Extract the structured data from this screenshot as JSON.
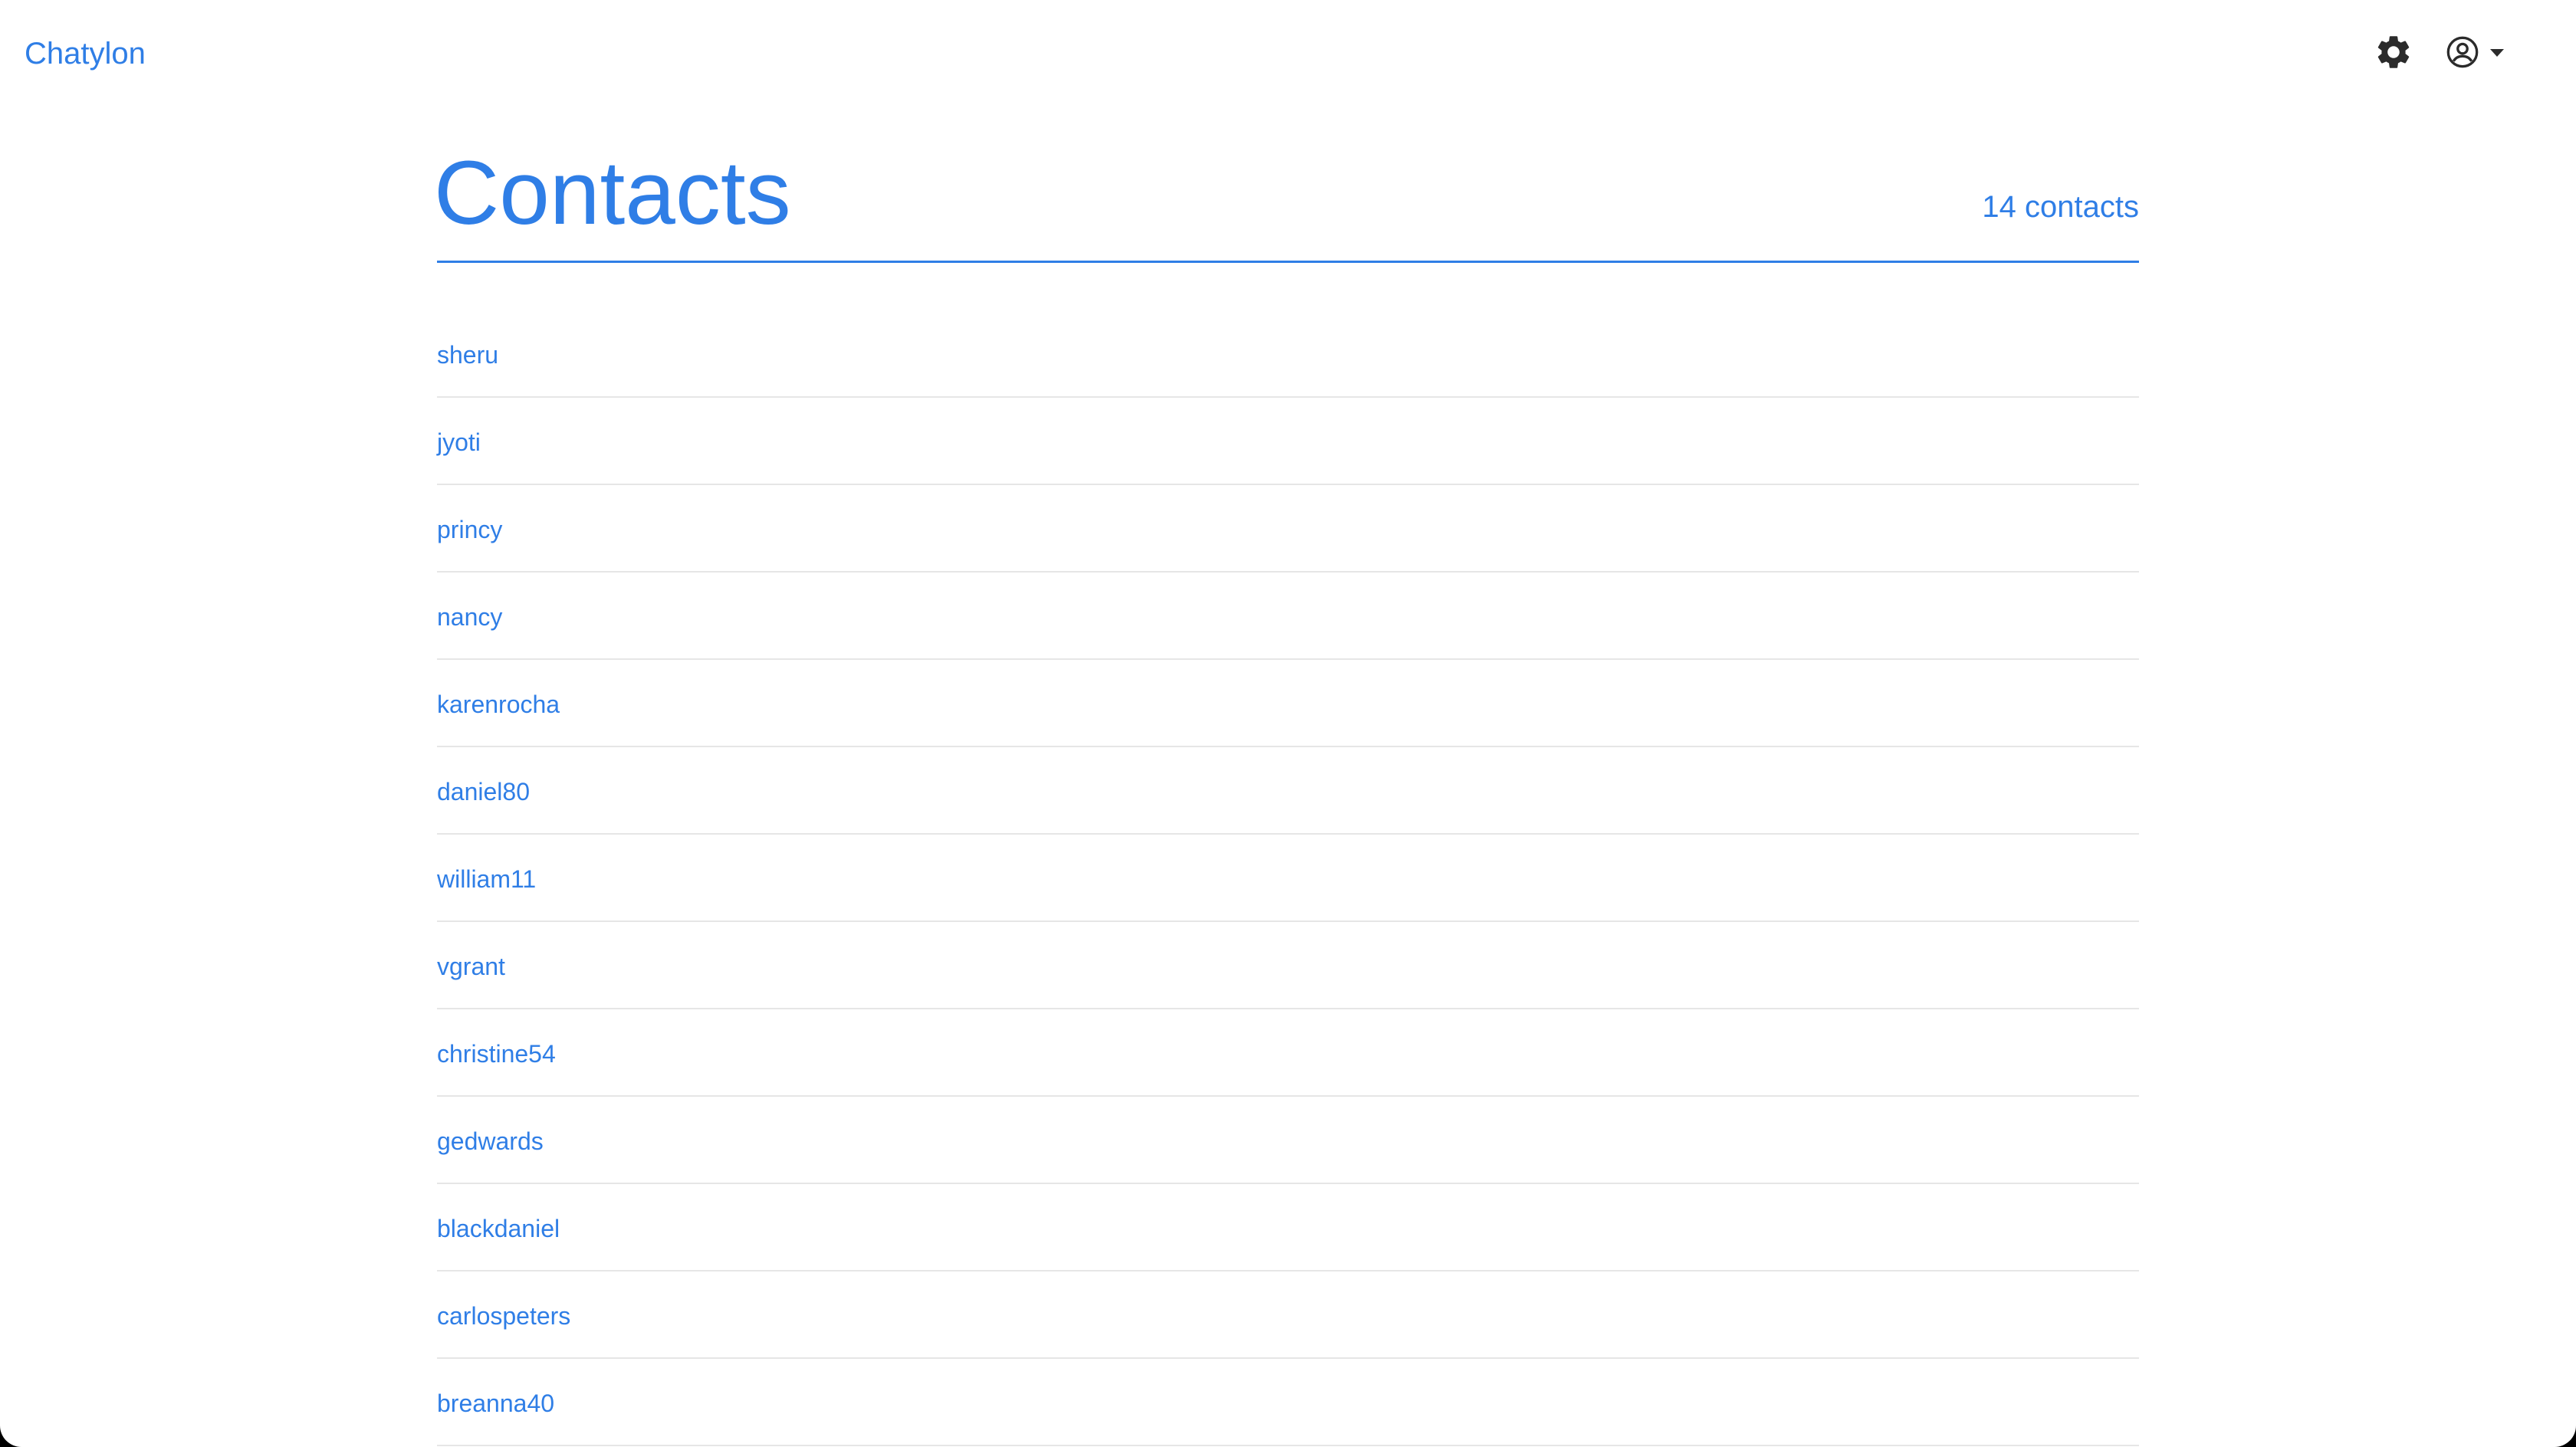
{
  "navbar": {
    "brand": "Chatylon",
    "settings_icon": "gear-icon",
    "account_icon": "user-circle-icon",
    "account_caret_icon": "caret-down-icon"
  },
  "header": {
    "title": "Contacts",
    "count_label": "14 contacts"
  },
  "contacts": [
    {
      "name": "sheru"
    },
    {
      "name": "jyoti"
    },
    {
      "name": "princy"
    },
    {
      "name": "nancy"
    },
    {
      "name": "karenrocha"
    },
    {
      "name": "daniel80"
    },
    {
      "name": "william11"
    },
    {
      "name": "vgrant"
    },
    {
      "name": "christine54"
    },
    {
      "name": "gedwards"
    },
    {
      "name": "blackdaniel"
    },
    {
      "name": "carlospeters"
    },
    {
      "name": "breanna40"
    }
  ],
  "colors": {
    "accent": "#2f7ee6",
    "divider": "#e6e6e6",
    "icon": "#2b2b2b"
  }
}
